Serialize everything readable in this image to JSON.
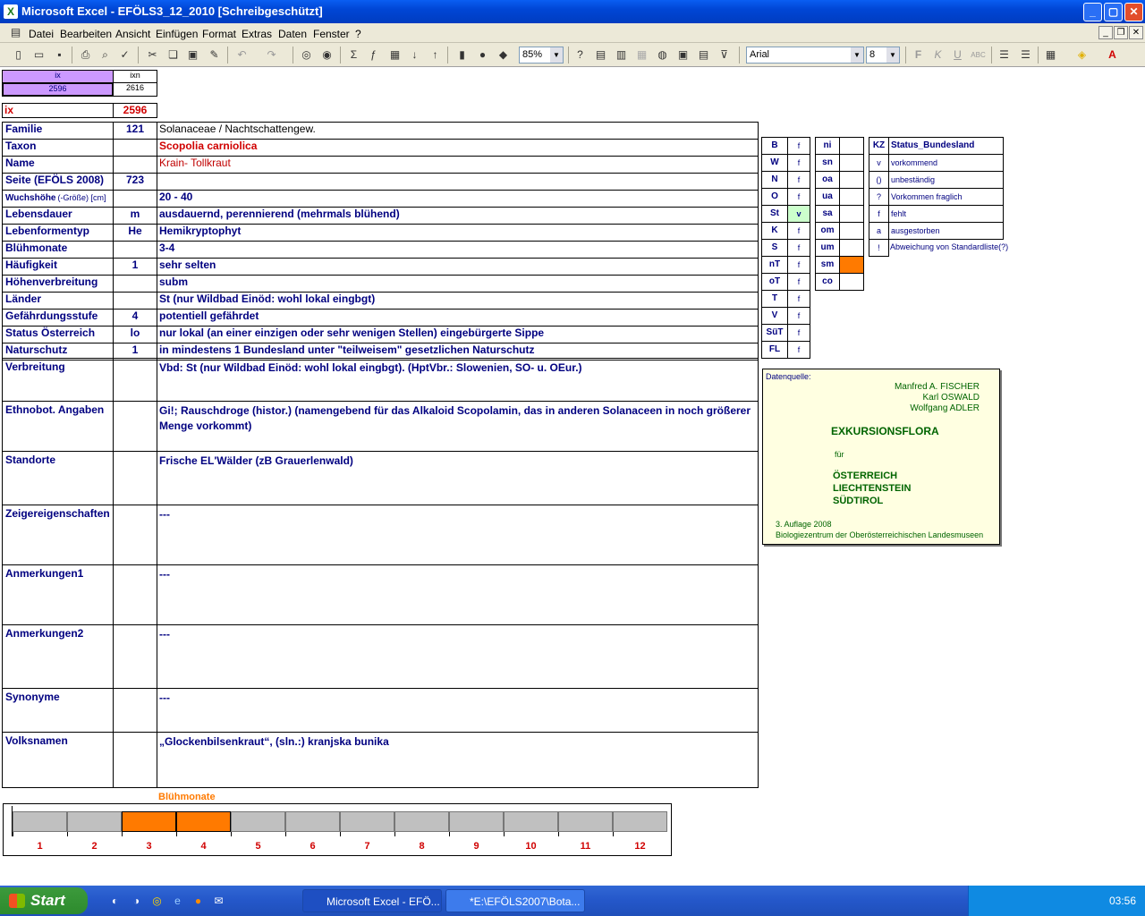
{
  "window": {
    "title": "Microsoft Excel - EFÖLS3_12_2010  [Schreibgeschützt]"
  },
  "menu": [
    "Datei",
    "Bearbeiten",
    "Ansicht",
    "Einfügen",
    "Format",
    "Extras",
    "Daten",
    "Fenster",
    "?"
  ],
  "toolbar": {
    "zoom": "85%",
    "font": "Arial",
    "size": "8"
  },
  "ix": {
    "h1": "ix",
    "h2": "ixn",
    "v1": "2596",
    "v2": "2616",
    "label": "ix",
    "value": "2596"
  },
  "rows": [
    {
      "label": "Familie",
      "code": "121",
      "value": "Solanaceae  /  Nachtschattengew."
    },
    {
      "label": "Taxon",
      "code": "",
      "value": "Scopolia carniolica"
    },
    {
      "label": "Name",
      "code": "",
      "value": "Krain- Tollkraut"
    },
    {
      "label": "Seite (EFÖLS 2008)",
      "code": "723",
      "value": ""
    },
    {
      "label": "Wuchshöhe",
      "sublabel": "(-Größe) [cm]",
      "code": "",
      "value": " 20 - 40"
    },
    {
      "label": "Lebensdauer",
      "code": "m",
      "value": "ausdauernd, perennierend (mehrmals blühend)"
    },
    {
      "label": "Lebenformentyp",
      "code": "He",
      "value": "Hemikryptophyt"
    },
    {
      "label": "Blühmonate",
      "code": "",
      "value": " 3-4"
    },
    {
      "label": "Häufigkeit",
      "code": "1",
      "value": "sehr selten"
    },
    {
      "label": "Höhenverbreitung",
      "code": "",
      "value": "subm"
    },
    {
      "label": "Länder",
      "code": "",
      "value": "St (nur Wildbad Einöd: wohl lokal eingbgt)"
    },
    {
      "label": "Gefährdungsstufe",
      "code": "4",
      "value": "potentiell gefährdet"
    },
    {
      "label": "Status Österreich",
      "code": "lo",
      "value": "nur lokal (an einer einzigen oder sehr wenigen Stellen) eingebürgerte Sippe"
    },
    {
      "label": "Naturschutz",
      "code": "1",
      "value": "in mindestens 1 Bundesland unter \"teilweisem\" gesetzlichen Naturschutz"
    }
  ],
  "tall": [
    {
      "label": "Verbreitung",
      "value": "Vbd:  St (nur Wildbad Einöd: wohl lokal eingbgt). (HptVbr.: Slowenien, SO- u. OEur.)"
    },
    {
      "label": "Ethnobot. Angaben",
      "value": "Gi!; Rauschdroge (histor.) (namengebend für das Alkaloid Scopolamin, das in anderen Solanaceen in noch größerer",
      "value2": "Menge vorkommt)"
    },
    {
      "label": "Standorte",
      "value": "Frische EL'Wälder (zB Grauerlenwald)"
    },
    {
      "label": "Zeigereigenschaften",
      "value": "---"
    },
    {
      "label": "Anmerkungen1",
      "value": "---"
    },
    {
      "label": "Anmerkungen2",
      "value": "---"
    },
    {
      "label": "Synonyme",
      "value": "---"
    },
    {
      "label": "Volksnamen",
      "value": "„Glockenbilsenkraut“, (sln.:) kranjska bunika"
    }
  ],
  "bl": [
    [
      "B",
      "f"
    ],
    [
      "W",
      "f"
    ],
    [
      "N",
      "f"
    ],
    [
      "O",
      "f"
    ],
    [
      "St",
      "v"
    ],
    [
      "K",
      "f"
    ],
    [
      "S",
      "f"
    ],
    [
      "nT",
      "f"
    ],
    [
      "oT",
      "f"
    ],
    [
      "T",
      "f"
    ],
    [
      "V",
      "f"
    ],
    [
      "SüT",
      "f"
    ],
    [
      "FL",
      "f"
    ]
  ],
  "hz": [
    "ni",
    "sn",
    "oa",
    "ua",
    "sa",
    "om",
    "um",
    "sm",
    "co"
  ],
  "kz": {
    "h1": "KZ",
    "h2": "Status_Bundesland",
    "items": [
      [
        "v",
        "vorkommend"
      ],
      [
        "()",
        "unbeständig"
      ],
      [
        "?",
        "Vorkommen fraglich"
      ],
      [
        "f",
        "fehlt"
      ],
      [
        "a",
        "ausgestorben"
      ],
      [
        "!",
        "Abweichung von Standardliste(?)"
      ]
    ]
  },
  "source": {
    "label": "Datenquelle:",
    "authors": [
      "Manfred A. FISCHER",
      "Karl OSWALD",
      "Wolfgang ADLER"
    ],
    "title": "EXKURSIONSFLORA",
    "fuer": "für",
    "countries": [
      "ÖSTERREICH",
      "LIECHTENSTEIN",
      "SÜDTIROL"
    ],
    "edition": "3. Auflage 2008",
    "publisher": "Biologiezentrum der Oberösterreichischen Landesmuseen"
  },
  "chart_data": {
    "type": "bar",
    "title": "Blühmonate",
    "categories": [
      "1",
      "2",
      "3",
      "4",
      "5",
      "6",
      "7",
      "8",
      "9",
      "10",
      "11",
      "12"
    ],
    "values": [
      0,
      0,
      1,
      1,
      0,
      0,
      0,
      0,
      0,
      0,
      0,
      0
    ],
    "colors": {
      "on": "#ff7a00",
      "off": "#c0c0c0"
    }
  },
  "taskbar": {
    "start": "Start",
    "tasks": [
      "Microsoft Excel - EFÖ...",
      "*E:\\EFÖLS2007\\Bota..."
    ],
    "clock": "03:56"
  }
}
